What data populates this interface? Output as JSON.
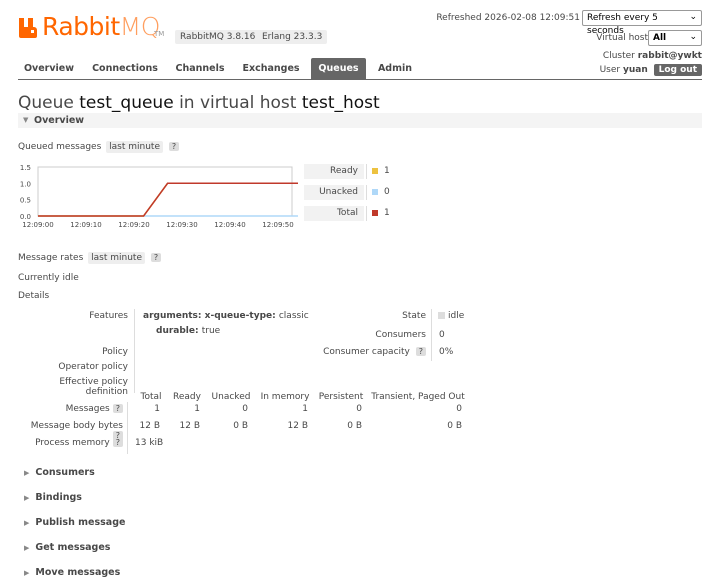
{
  "header": {
    "brand_a": "Rabbit",
    "brand_b": "MQ",
    "tm": "TM",
    "version_rmq": "RabbitMQ 3.8.16",
    "version_erlang": "Erlang 23.3.3",
    "refreshed": "Refreshed 2026-02-08 12:09:51",
    "refresh_select": "Refresh every 5 seconds",
    "vhost_label": "Virtual host",
    "vhost_select": "All",
    "cluster_label": "Cluster",
    "cluster_value": "rabbit@ywkt",
    "user_label": "User",
    "user_value": "yuan",
    "logout": "Log out",
    "brand_color": "#ff6600"
  },
  "nav": {
    "tabs": [
      "Overview",
      "Connections",
      "Channels",
      "Exchanges",
      "Queues",
      "Admin"
    ],
    "active": "Queues"
  },
  "title": {
    "prefix": "Queue",
    "queue": "test_queue",
    "middle": "in virtual host",
    "vhost": "test_host"
  },
  "overview": {
    "section": "Overview",
    "queued_label": "Queued messages",
    "queued_range": "last minute",
    "help": "?",
    "rates_label": "Message rates",
    "rates_range": "last minute",
    "idle": "Currently idle",
    "details": "Details"
  },
  "chart_data": {
    "type": "line",
    "x": [
      "12:09:00",
      "12:09:10",
      "12:09:20",
      "12:09:30",
      "12:09:40",
      "12:09:50"
    ],
    "yticks": [
      "0.0",
      "0.5",
      "1.0",
      "1.5"
    ],
    "ylim": [
      0,
      1.5
    ],
    "series": [
      {
        "name": "Total",
        "color": "#c0392b",
        "points": [
          [
            0,
            0
          ],
          [
            22,
            0
          ],
          [
            27,
            1
          ],
          [
            60,
            1
          ]
        ]
      },
      {
        "name": "Ready",
        "color": "#edc240",
        "points": [
          [
            0,
            0
          ],
          [
            22,
            0
          ],
          [
            27,
            1
          ],
          [
            60,
            1
          ]
        ]
      },
      {
        "name": "Unacked",
        "color": "#afd8f8",
        "points": [
          [
            0,
            0
          ],
          [
            60,
            0
          ]
        ]
      }
    ],
    "legend": [
      {
        "name": "Ready",
        "value": "1",
        "color": "#edc240"
      },
      {
        "name": "Unacked",
        "value": "0",
        "color": "#afd8f8"
      },
      {
        "name": "Total",
        "value": "1",
        "color": "#c0392b"
      }
    ]
  },
  "details": {
    "features_label": "Features",
    "arguments_key": "arguments:",
    "arguments_sub": "x-queue-type:",
    "arguments_val": "classic",
    "durable_key": "durable:",
    "durable_val": "true",
    "policy": "Policy",
    "operator_policy": "Operator policy",
    "effective_policy": "Effective policy definition",
    "state_label": "State",
    "state_value": "idle",
    "consumers_label": "Consumers",
    "consumers_value": "0",
    "capacity_label": "Consumer capacity",
    "capacity_value": "0%"
  },
  "msgtable": {
    "headers": [
      "Total",
      "Ready",
      "Unacked",
      "In memory",
      "Persistent",
      "Transient, Paged Out"
    ],
    "rows": [
      {
        "label": "Messages",
        "values": [
          "1",
          "1",
          "0",
          "1",
          "0",
          "0"
        ]
      },
      {
        "label": "Message body bytes",
        "values": [
          "12 B",
          "12 B",
          "0 B",
          "12 B",
          "0 B",
          "0 B"
        ]
      },
      {
        "label": "Process memory",
        "values": [
          "13 kiB"
        ]
      }
    ]
  },
  "sections": [
    "Consumers",
    "Bindings",
    "Publish message",
    "Get messages",
    "Move messages"
  ]
}
